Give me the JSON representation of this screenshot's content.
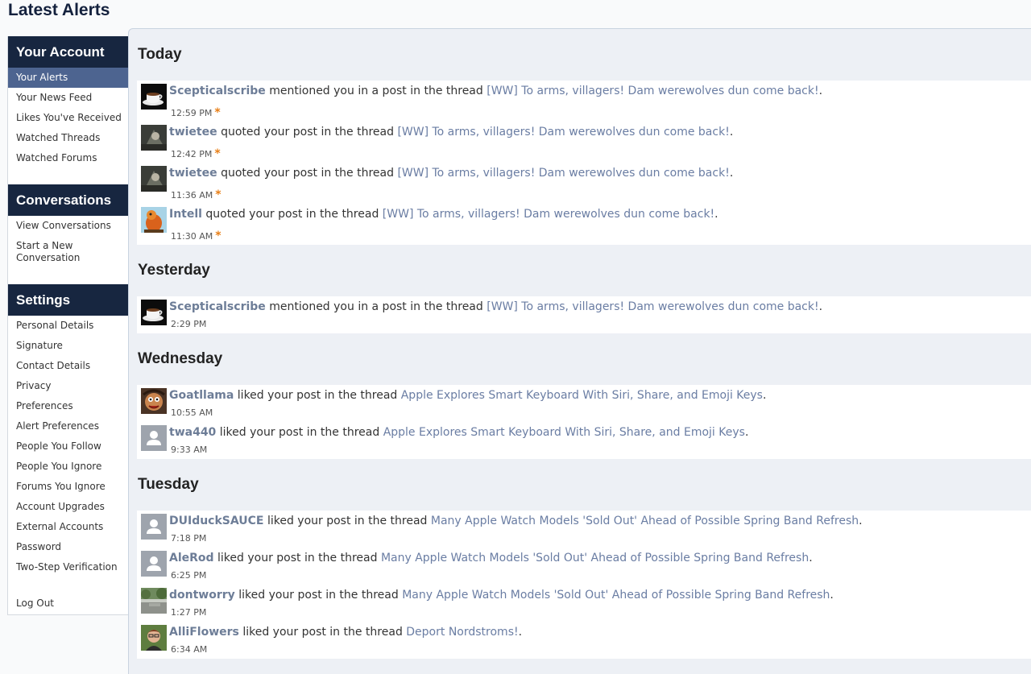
{
  "page_title": "Latest Alerts",
  "sidebar": {
    "account": {
      "heading": "Your Account",
      "items": [
        "Your Alerts",
        "Your News Feed",
        "Likes You've Received",
        "Watched Threads",
        "Watched Forums"
      ]
    },
    "conversations": {
      "heading": "Conversations",
      "items": [
        "View Conversations",
        "Start a New",
        "Conversation"
      ]
    },
    "settings": {
      "heading": "Settings",
      "items": [
        "Personal Details",
        "Signature",
        "Contact Details",
        "Privacy",
        "Preferences",
        "Alert Preferences",
        "People You Follow",
        "People You Ignore",
        "Forums You Ignore",
        "Account Upgrades",
        "External Accounts",
        "Password",
        "Two-Step Verification"
      ]
    },
    "logout": "Log Out"
  },
  "days": [
    "Today",
    "Yesterday",
    "Wednesday",
    "Tuesday"
  ],
  "alerts": [
    {
      "user": "Scepticalscribe",
      "action": "mentioned you in a post in the thread",
      "thread": "[WW] To arms, villagers! Dam werewolves dun come back!",
      "time": "12:59 PM",
      "new": "*",
      "avatar": "coffee-cup"
    },
    {
      "user": "twietee",
      "action": "quoted your post in the thread",
      "thread": "[WW] To arms, villagers! Dam werewolves dun come back!",
      "time": "12:42 PM",
      "new": "*",
      "avatar": "dark-photo"
    },
    {
      "user": "twietee",
      "action": "quoted your post in the thread",
      "thread": "[WW] To arms, villagers! Dam werewolves dun come back!",
      "time": "11:36 AM",
      "new": "*",
      "avatar": "dark-photo"
    },
    {
      "user": "Intell",
      "action": "quoted your post in the thread",
      "thread": "[WW] To arms, villagers! Dam werewolves dun come back!",
      "time": "11:30 AM",
      "new": "*",
      "avatar": "orange-bird"
    },
    {
      "user": "Scepticalscribe",
      "action": "mentioned you in a post in the thread",
      "thread": "[WW] To arms, villagers! Dam werewolves dun come back!",
      "time": "2:29 PM",
      "new": "",
      "avatar": "coffee-cup"
    },
    {
      "user": "Goatllama",
      "action": "liked your post in the thread",
      "thread": "Apple Explores Smart Keyboard With Siri, Share, and Emoji Keys",
      "time": "10:55 AM",
      "new": "",
      "avatar": "cartoon-face"
    },
    {
      "user": "twa440",
      "action": "liked your post in the thread",
      "thread": "Apple Explores Smart Keyboard With Siri, Share, and Emoji Keys",
      "time": "9:33 AM",
      "new": "",
      "avatar": "default-user"
    },
    {
      "user": "DUIduckSAUCE",
      "action": "liked your post in the thread",
      "thread": "Many Apple Watch Models 'Sold Out' Ahead of Possible Spring Band Refresh",
      "time": "7:18 PM",
      "new": "",
      "avatar": "default-user"
    },
    {
      "user": "AleRod",
      "action": "liked your post in the thread",
      "thread": "Many Apple Watch Models 'Sold Out' Ahead of Possible Spring Band Refresh",
      "time": "6:25 PM",
      "new": "",
      "avatar": "default-user"
    },
    {
      "user": "dontworry",
      "action": "liked your post in the thread",
      "thread": "Many Apple Watch Models 'Sold Out' Ahead of Possible Spring Band Refresh",
      "time": "1:27 PM",
      "new": "",
      "avatar": "landscape-photo"
    },
    {
      "user": "AlliFlowers",
      "action": "liked your post in the thread",
      "thread": "Deport Nordstroms!",
      "time": "6:34 AM",
      "new": "",
      "avatar": "person-photo"
    }
  ],
  "period": "."
}
